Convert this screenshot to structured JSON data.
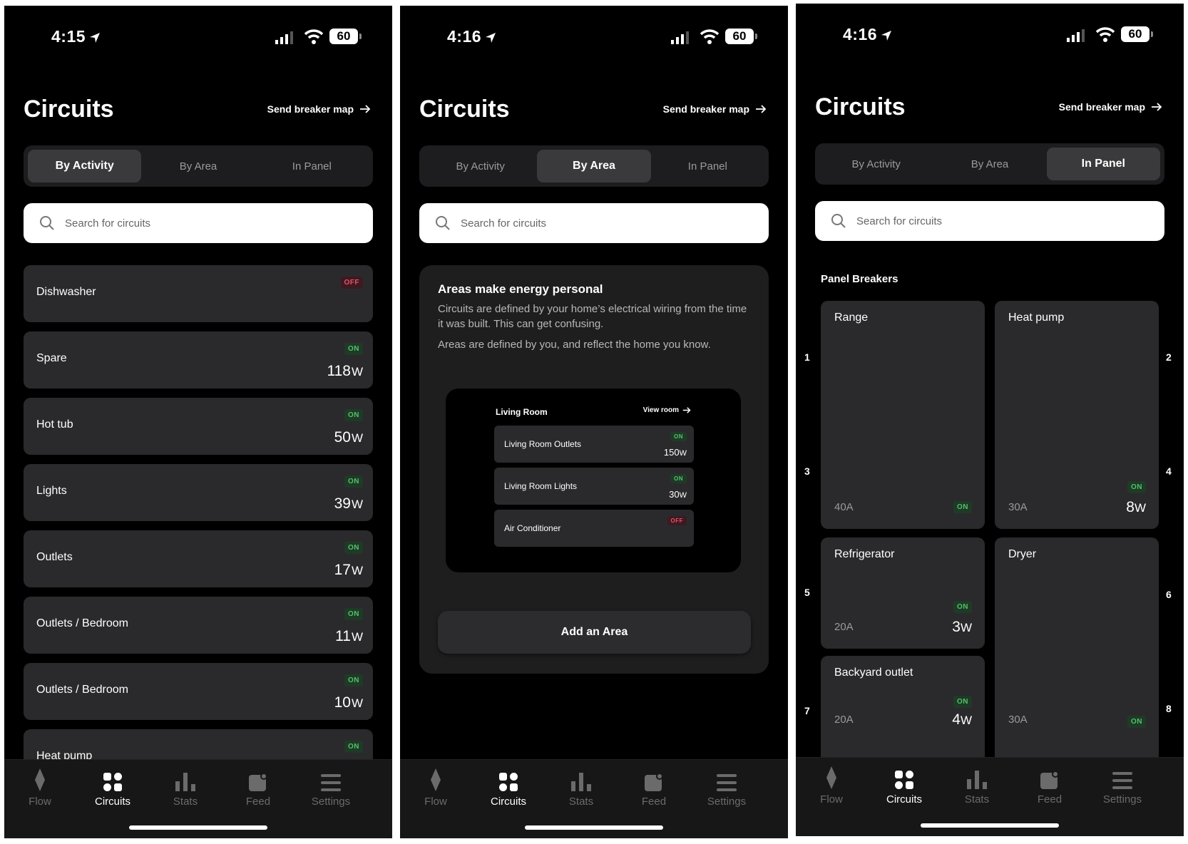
{
  "status": {
    "screen1_time": "4:15",
    "screen2_time": "4:16",
    "screen3_time": "4:16",
    "battery": "60"
  },
  "header": {
    "title": "Circuits",
    "send_link": "Send breaker map"
  },
  "segments": [
    "By Activity",
    "By Area",
    "In Panel"
  ],
  "search_placeholder": "Search for circuits",
  "activity_list": [
    {
      "name": "Dishwasher",
      "status": "OFF",
      "watts": ""
    },
    {
      "name": "Spare",
      "status": "ON",
      "watts": "118"
    },
    {
      "name": "Hot tub",
      "status": "ON",
      "watts": "50"
    },
    {
      "name": "Lights",
      "status": "ON",
      "watts": "39"
    },
    {
      "name": "Outlets",
      "status": "ON",
      "watts": "17"
    },
    {
      "name": "Outlets / Bedroom",
      "status": "ON",
      "watts": "11"
    },
    {
      "name": "Outlets / Bedroom",
      "status": "ON",
      "watts": "10"
    },
    {
      "name": "Heat pump",
      "status": "ON",
      "watts": ""
    }
  ],
  "watt_unit": "W",
  "area_card": {
    "title": "Areas make energy personal",
    "paragraph1": "Circuits are defined by your home’s electrical wiring from the time it was built. This can get confusing.",
    "paragraph2": "Areas are defined by you, and reflect the home you know.",
    "preview_room": "Living Room",
    "preview_view_link": "View room",
    "preview_rows": [
      {
        "name": "Living Room Outlets",
        "status": "ON",
        "watts": "150"
      },
      {
        "name": "Living Room Lights",
        "status": "ON",
        "watts": "30"
      },
      {
        "name": "Air Conditioner",
        "status": "OFF",
        "watts": ""
      }
    ],
    "add_button": "Add an Area"
  },
  "panel": {
    "section_title": "Panel Breakers",
    "numbers": [
      "1",
      "2",
      "3",
      "4",
      "5",
      "6",
      "7",
      "8"
    ],
    "breakers": [
      {
        "name": "Range",
        "amps": "40A",
        "status": "ON",
        "watts": ""
      },
      {
        "name": "Heat pump",
        "amps": "30A",
        "status": "ON",
        "watts": "8"
      },
      {
        "name": "Refrigerator",
        "amps": "20A",
        "status": "ON",
        "watts": "3"
      },
      {
        "name": "Dryer",
        "amps": "30A",
        "status": "ON",
        "watts": ""
      },
      {
        "name": "Backyard outlet",
        "amps": "20A",
        "status": "ON",
        "watts": "4"
      }
    ]
  },
  "tabbar": [
    "Flow",
    "Circuits",
    "Stats",
    "Feed",
    "Settings"
  ],
  "colors": {
    "background": "#000000",
    "row": "#2a2a2c",
    "on_badge": "#52c26a",
    "off_badge": "#e45366"
  }
}
